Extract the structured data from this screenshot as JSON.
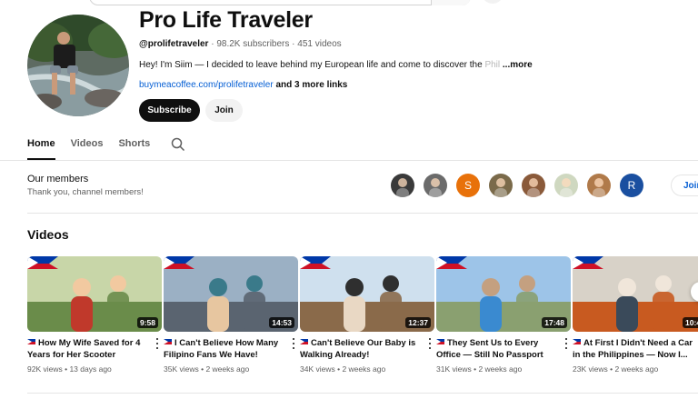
{
  "channel": {
    "title": "Pro Life Traveler",
    "handle": "@prolifetraveler",
    "subscribers": "98.2K subscribers",
    "video_count": "451 videos",
    "description": "Hey! I'm Siim — I decided to leave behind my European life and come to discover the ",
    "description_fade": "Phil",
    "more_label": "...more",
    "link_url": "buymeacoffee.com/prolifetraveler",
    "link_extra": "and 3 more links",
    "subscribe_label": "Subscribe",
    "join_label": "Join"
  },
  "tabs": [
    {
      "label": "Home",
      "active": true
    },
    {
      "label": "Videos",
      "active": false
    },
    {
      "label": "Shorts",
      "active": false
    }
  ],
  "members": {
    "title": "Our members",
    "subtitle": "Thank you, channel members!",
    "avatars": [
      {
        "kind": "photo",
        "color": "#3a3a3a"
      },
      {
        "kind": "photo",
        "color": "#6b6b6b"
      },
      {
        "kind": "letter",
        "letter": "S",
        "color": "#e8710a"
      },
      {
        "kind": "photo",
        "color": "#7a6a4a"
      },
      {
        "kind": "photo",
        "color": "#8a5a3a"
      },
      {
        "kind": "photo",
        "color": "#cfd8c0"
      },
      {
        "kind": "photo",
        "color": "#b07a4a"
      },
      {
        "kind": "letter",
        "letter": "R",
        "color": "#1a4fa0"
      }
    ],
    "join_label": "Join"
  },
  "videos_section": {
    "title": "Videos",
    "items": [
      {
        "title": "How My Wife Saved for 4 Years for Her Scooter",
        "duration": "9:58",
        "views": "92K views",
        "age": "13 days ago"
      },
      {
        "title": "I Can't Believe How Many Filipino Fans We Have!",
        "duration": "14:53",
        "views": "35K views",
        "age": "2 weeks ago"
      },
      {
        "title": "Can't Believe Our Baby is Walking Already!",
        "duration": "12:37",
        "views": "34K views",
        "age": "2 weeks ago"
      },
      {
        "title": "They Sent Us to Every Office — Still No Passport",
        "duration": "17:48",
        "views": "31K views",
        "age": "2 weeks ago"
      },
      {
        "title": "At First I Didn't Need a Car in the Philippines — Now I...",
        "duration": "10:4",
        "views": "23K views",
        "age": "2 weeks ago"
      }
    ]
  }
}
